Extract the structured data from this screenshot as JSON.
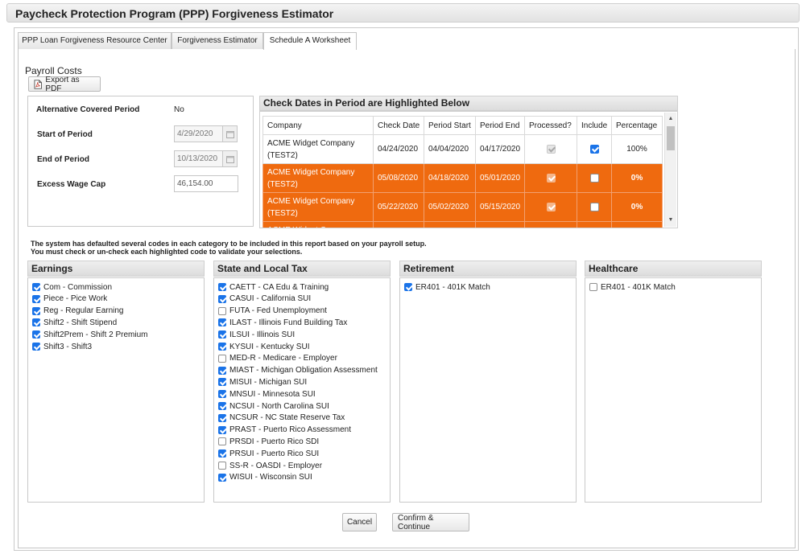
{
  "window": {
    "title": "Paycheck Protection Program (PPP) Forgiveness Estimator"
  },
  "tabs": [
    {
      "label": "PPP Loan Forgiveness Resource Center",
      "active": false
    },
    {
      "label": "Forgiveness Estimator",
      "active": false
    },
    {
      "label": "Schedule A Worksheet",
      "active": true
    }
  ],
  "section": {
    "title": "Payroll Costs",
    "export_label": "Export as PDF"
  },
  "period": {
    "alt_label": "Alternative Covered Period",
    "alt_value": "No",
    "start_label": "Start of Period",
    "start_value": "4/29/2020",
    "end_label": "End of Period",
    "end_value": "10/13/2020",
    "cap_label": "Excess Wage Cap",
    "cap_value": "46,154.00"
  },
  "check_dates": {
    "title": "Check Dates in Period are Highlighted Below",
    "columns": [
      "Company",
      "Check Date",
      "Period Start",
      "Period End",
      "Processed?",
      "Include",
      "Percentage"
    ],
    "rows": [
      {
        "company": "ACME Widget Company (TEST2)",
        "check_date": "04/24/2020",
        "period_start": "04/04/2020",
        "period_end": "04/17/2020",
        "processed": true,
        "include": true,
        "percentage": "100%",
        "highlighted": false
      },
      {
        "company": "ACME Widget Company (TEST2)",
        "check_date": "05/08/2020",
        "period_start": "04/18/2020",
        "period_end": "05/01/2020",
        "processed": true,
        "include": false,
        "percentage": "0%",
        "highlighted": true
      },
      {
        "company": "ACME Widget Company (TEST2)",
        "check_date": "05/22/2020",
        "period_start": "05/02/2020",
        "period_end": "05/15/2020",
        "processed": true,
        "include": false,
        "percentage": "0%",
        "highlighted": true
      },
      {
        "company": "ACME Widget Company (TEST2)",
        "check_date": "",
        "period_start": "",
        "period_end": "",
        "processed": true,
        "include": false,
        "percentage": "",
        "highlighted": true
      }
    ],
    "highlight_color": "#ef6a0f"
  },
  "notice": {
    "line1": "The system has defaulted several codes in each category to be included in this report based on your payroll setup.",
    "line2": "You must check or un-check each highlighted code to validate your selections."
  },
  "categories": {
    "earnings": {
      "title": "Earnings",
      "items": [
        {
          "label": "Com - Commission",
          "checked": true
        },
        {
          "label": "Piece - Pice Work",
          "checked": true
        },
        {
          "label": "Reg - Regular Earning",
          "checked": true
        },
        {
          "label": "Shift2 - Shift Stipend",
          "checked": true
        },
        {
          "label": "Shift2Prem - Shift 2 Premium",
          "checked": true
        },
        {
          "label": "Shift3 - Shift3",
          "checked": true
        }
      ]
    },
    "state_tax": {
      "title": "State and Local Tax",
      "items": [
        {
          "label": "CAETT - CA Edu & Training",
          "checked": true
        },
        {
          "label": "CASUI - California SUI",
          "checked": true
        },
        {
          "label": "FUTA - Fed Unemployment",
          "checked": false
        },
        {
          "label": "ILAST - Illinois Fund Building Tax",
          "checked": true
        },
        {
          "label": "ILSUI - Illinois SUI",
          "checked": true
        },
        {
          "label": "KYSUI - Kentucky SUI",
          "checked": true
        },
        {
          "label": "MED-R - Medicare - Employer",
          "checked": false
        },
        {
          "label": "MIAST - Michigan Obligation Assessment",
          "checked": true
        },
        {
          "label": "MISUI - Michigan SUI",
          "checked": true
        },
        {
          "label": "MNSUI - Minnesota SUI",
          "checked": true
        },
        {
          "label": "NCSUI - North Carolina SUI",
          "checked": true
        },
        {
          "label": "NCSUR - NC State Reserve Tax",
          "checked": true
        },
        {
          "label": "PRAST - Puerto Rico Assessment",
          "checked": true
        },
        {
          "label": "PRSDI - Puerto Rico SDI",
          "checked": false
        },
        {
          "label": "PRSUI - Puerto Rico SUI",
          "checked": true
        },
        {
          "label": "SS-R - OASDI - Employer",
          "checked": false
        },
        {
          "label": "WISUI - Wisconsin SUI",
          "checked": true
        }
      ]
    },
    "retirement": {
      "title": "Retirement",
      "items": [
        {
          "label": "ER401 - 401K Match",
          "checked": true
        }
      ]
    },
    "healthcare": {
      "title": "Healthcare",
      "items": [
        {
          "label": "ER401 - 401K Match",
          "checked": false
        }
      ]
    }
  },
  "actions": {
    "cancel": "Cancel",
    "confirm": "Confirm & Continue"
  }
}
